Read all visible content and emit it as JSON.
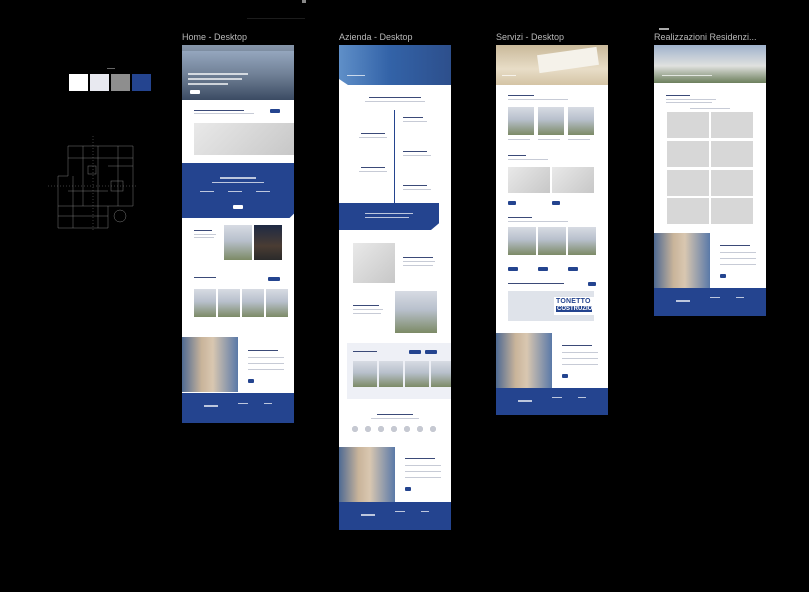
{
  "canvas": {
    "background": "#000000"
  },
  "palette": {
    "colors": [
      "#ffffff",
      "#e8e9f0",
      "#8e8e8e",
      "#24448f"
    ]
  },
  "frames": [
    {
      "id": "home",
      "title": "Home - Desktop"
    },
    {
      "id": "azienda",
      "title": "Azienda - Desktop"
    },
    {
      "id": "servizi",
      "title": "Servizi - Desktop"
    },
    {
      "id": "realizzazioni",
      "title": "Realizzazioni Residenzi..."
    }
  ],
  "servizi_brand": {
    "logo_text": "TONETTO",
    "logo_sub": "COSTRUZIONI"
  }
}
